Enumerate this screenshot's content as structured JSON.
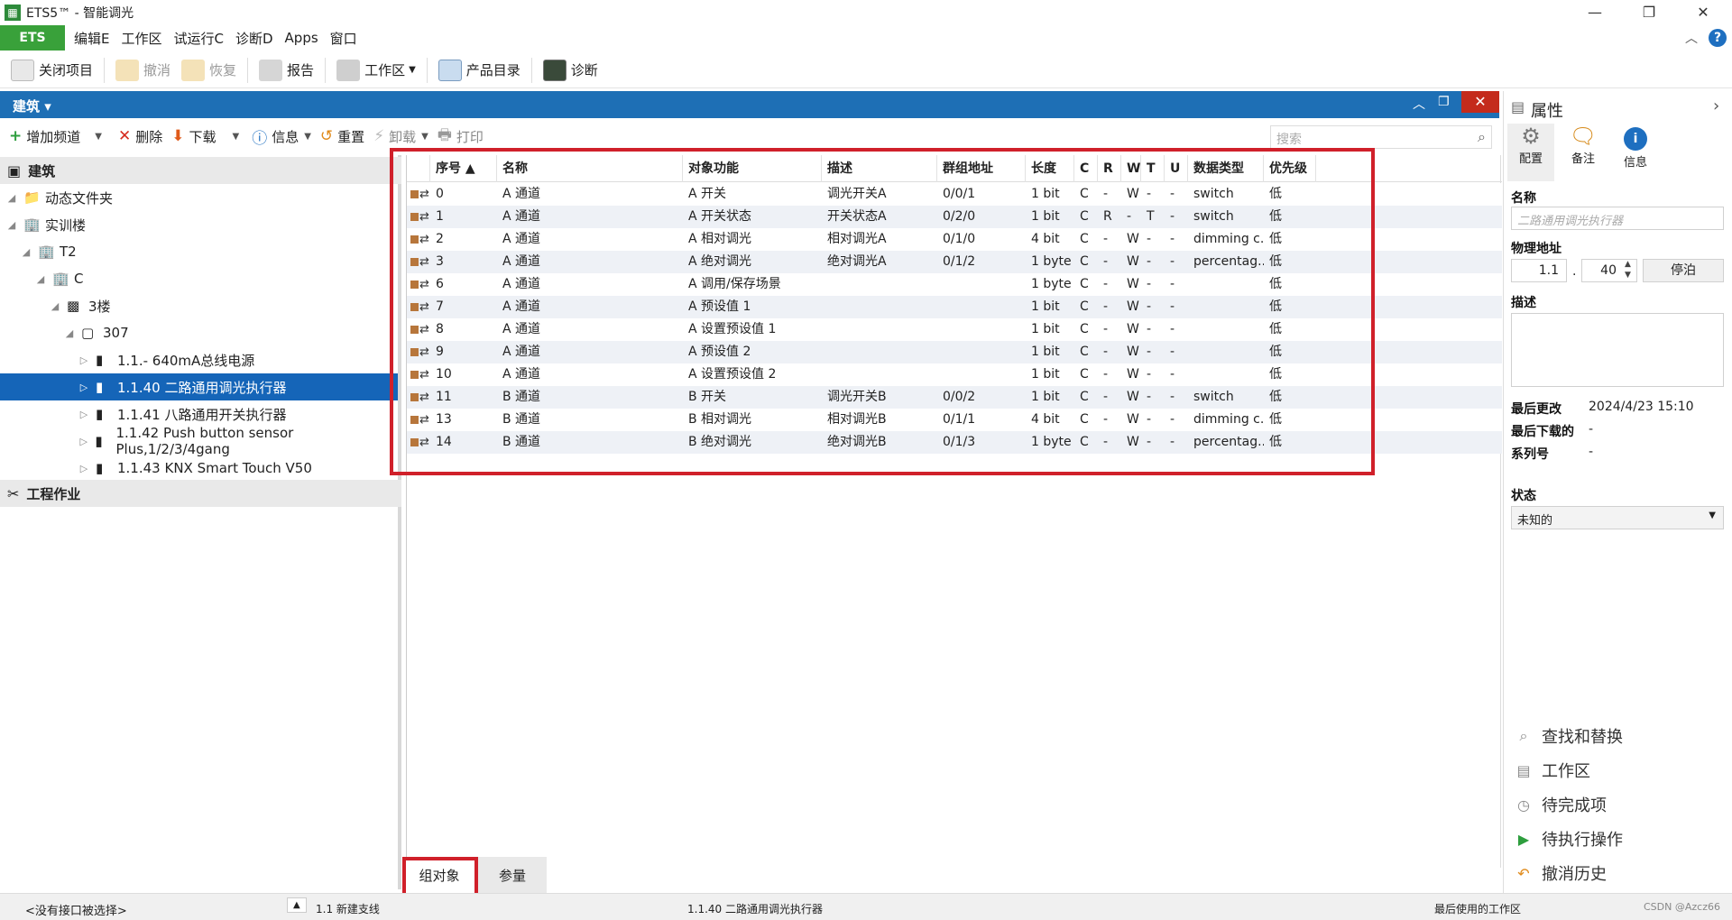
{
  "window": {
    "title": "ETS5™ - 智能调光",
    "minimize": "—",
    "maximize": "❐",
    "close": "✕"
  },
  "menu": {
    "ets": "ETS",
    "items": [
      "编辑E",
      "工作区",
      "试运行C",
      "诊断D",
      "Apps",
      "窗口"
    ],
    "collapse": "︿",
    "help": "?"
  },
  "toolbar": {
    "close_project": "关闭项目",
    "undo": "撤消",
    "redo": "恢复",
    "report": "报告",
    "workspace": "工作区",
    "catalog": "产品目录",
    "diagnose": "诊断"
  },
  "panel": {
    "title": "建筑 ▾",
    "restore": "︿",
    "float": "❐",
    "close": "✕"
  },
  "subtoolbar": {
    "add_channel": "增加频道",
    "delete": "删除",
    "download": "下载",
    "info": "信息",
    "reset": "重置",
    "unload": "卸载",
    "print": "打印"
  },
  "search": {
    "placeholder": "搜索"
  },
  "tree": {
    "section1": "建筑",
    "items": [
      {
        "label": "动态文件夹",
        "indent": 0
      },
      {
        "label": "实训楼",
        "indent": 0
      },
      {
        "label": "T2",
        "indent": 1
      },
      {
        "label": "C",
        "indent": 2
      },
      {
        "label": "3楼",
        "indent": 3
      },
      {
        "label": "307",
        "indent": 4
      },
      {
        "label": "1.1.- 640mA总线电源",
        "indent": 5
      },
      {
        "label": "1.1.40 二路通用调光执行器",
        "indent": 5,
        "selected": true
      },
      {
        "label": "1.1.41 八路通用开关执行器",
        "indent": 5
      },
      {
        "label": "1.1.42 Push button sensor Plus,1/2/3/4gang",
        "indent": 5
      },
      {
        "label": "1.1.43 KNX Smart Touch V50",
        "indent": 5
      }
    ],
    "section2": "工程作业"
  },
  "grid": {
    "columns": [
      "序号 ▲",
      "名称",
      "对象功能",
      "描述",
      "群组地址",
      "长度",
      "C",
      "R",
      "W",
      "T",
      "U",
      "数据类型",
      "优先级"
    ],
    "rows": [
      [
        "0",
        "A 通道",
        "A 开关",
        "调光开关A",
        "0/0/1",
        "1 bit",
        "C",
        "-",
        "W",
        "-",
        "-",
        "switch",
        "低"
      ],
      [
        "1",
        "A 通道",
        "A 开关状态",
        "开关状态A",
        "0/2/0",
        "1 bit",
        "C",
        "R",
        "-",
        "T",
        "-",
        "switch",
        "低"
      ],
      [
        "2",
        "A 通道",
        "A 相对调光",
        "相对调光A",
        "0/1/0",
        "4 bit",
        "C",
        "-",
        "W",
        "-",
        "-",
        "dimming c...",
        "低"
      ],
      [
        "3",
        "A 通道",
        "A 绝对调光",
        "绝对调光A",
        "0/1/2",
        "1 byte",
        "C",
        "-",
        "W",
        "-",
        "-",
        "percentag...",
        "低"
      ],
      [
        "6",
        "A 通道",
        "A 调用/保存场景",
        "",
        "",
        "1 byte",
        "C",
        "-",
        "W",
        "-",
        "-",
        "",
        "低"
      ],
      [
        "7",
        "A 通道",
        "A 预设值 1",
        "",
        "",
        "1 bit",
        "C",
        "-",
        "W",
        "-",
        "-",
        "",
        "低"
      ],
      [
        "8",
        "A 通道",
        "A 设置预设值 1",
        "",
        "",
        "1 bit",
        "C",
        "-",
        "W",
        "-",
        "-",
        "",
        "低"
      ],
      [
        "9",
        "A 通道",
        "A 预设值 2",
        "",
        "",
        "1 bit",
        "C",
        "-",
        "W",
        "-",
        "-",
        "",
        "低"
      ],
      [
        "10",
        "A 通道",
        "A 设置预设值 2",
        "",
        "",
        "1 bit",
        "C",
        "-",
        "W",
        "-",
        "-",
        "",
        "低"
      ],
      [
        "11",
        "B 通道",
        "B 开关",
        "调光开关B",
        "0/0/2",
        "1 bit",
        "C",
        "-",
        "W",
        "-",
        "-",
        "switch",
        "低"
      ],
      [
        "13",
        "B 通道",
        "B 相对调光",
        "相对调光B",
        "0/1/1",
        "4 bit",
        "C",
        "-",
        "W",
        "-",
        "-",
        "dimming c...",
        "低"
      ],
      [
        "14",
        "B 通道",
        "B 绝对调光",
        "绝对调光B",
        "0/1/3",
        "1 byte",
        "C",
        "-",
        "W",
        "-",
        "-",
        "percentag...",
        "低"
      ]
    ]
  },
  "tabs": {
    "group_objects": "组对象",
    "parameters": "参量"
  },
  "properties": {
    "title": "属性",
    "expand": "›",
    "tabs": [
      "配置",
      "备注",
      "信息"
    ],
    "name_label": "名称",
    "name_placeholder": "二路通用调光执行器",
    "phys_label": "物理地址",
    "phys_prefix": "1.1",
    "phys_dot": ".",
    "phys_value": "40",
    "park_button": "停泊",
    "desc_label": "描述",
    "last_modified_label": "最后更改",
    "last_modified": "2024/4/23 15:10",
    "last_download_label": "最后下载的",
    "last_download": "-",
    "serial_label": "系列号",
    "serial": "-",
    "status_label": "状态",
    "status_value": "未知的",
    "links": [
      "查找和替换",
      "工作区",
      "待完成项",
      "待执行操作",
      "撤消历史"
    ]
  },
  "statusbar": {
    "interface": "<没有接口被选择>",
    "line": "1.1 新建支线",
    "device": "1.1.40 二路通用调光执行器",
    "workspace": "最后使用的工作区",
    "watermark": "CSDN @Azcz66"
  }
}
